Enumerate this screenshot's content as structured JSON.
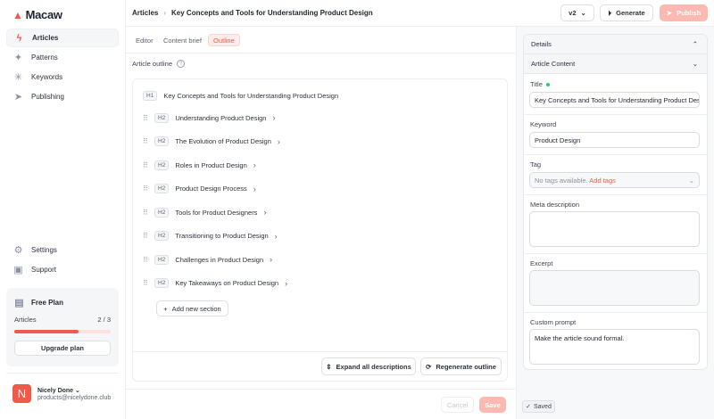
{
  "app": {
    "name": "Macaw"
  },
  "sidebar": {
    "items": [
      {
        "label": "Articles",
        "icon": "bolt-icon"
      },
      {
        "label": "Patterns",
        "icon": "sparkles-icon"
      },
      {
        "label": "Keywords",
        "icon": "asterisk-icon"
      },
      {
        "label": "Publishing",
        "icon": "send-icon"
      }
    ],
    "bottom": [
      {
        "label": "Settings"
      },
      {
        "label": "Support"
      }
    ],
    "plan": {
      "title": "Free Plan",
      "articles_label": "Articles",
      "count": "2 / 3",
      "progress": 0.667,
      "upgrade": "Upgrade plan"
    },
    "user": {
      "initial": "N",
      "name": "Nicely Done",
      "email": "products@nicelydone.club"
    }
  },
  "header": {
    "breadcrumb_root": "Articles",
    "breadcrumb_current": "Key Concepts and Tools for Understanding Product Design",
    "version": "v2",
    "generate": "Generate",
    "publish": "Publish"
  },
  "tabs": [
    {
      "label": "Editor"
    },
    {
      "label": "Content brief"
    },
    {
      "label": "Outline"
    }
  ],
  "outline": {
    "label": "Article outline",
    "h1": {
      "level": "H1",
      "text": "Key Concepts and Tools for Understanding Product Design"
    },
    "sections": [
      {
        "level": "H2",
        "text": "Understanding Product Design"
      },
      {
        "level": "H2",
        "text": "The Evolution of Product Design"
      },
      {
        "level": "H2",
        "text": "Roles in Product Design"
      },
      {
        "level": "H2",
        "text": "Product Design Process"
      },
      {
        "level": "H2",
        "text": "Tools for Product Designers"
      },
      {
        "level": "H2",
        "text": "Transitioning to Product Design"
      },
      {
        "level": "H2",
        "text": "Challenges in Product Design"
      },
      {
        "level": "H2",
        "text": "Key Takeaways on Product Design"
      }
    ],
    "add_section": "Add new section",
    "expand": "Expand all descriptions",
    "regenerate": "Regenerate outline"
  },
  "footer": {
    "cancel": "Cancel",
    "save": "Save",
    "saved": "Saved"
  },
  "details": {
    "title": "Details",
    "section": "Article Content",
    "title_label": "Title",
    "title_value": "Key Concepts and Tools for Understanding Product Design",
    "keyword_label": "Keyword",
    "keyword_value": "Product Design",
    "tag_label": "Tag",
    "tag_empty": "No tags available.",
    "tag_add": "Add tags",
    "meta_label": "Meta description",
    "meta_value": "",
    "excerpt_label": "Excerpt",
    "excerpt_value": "",
    "prompt_label": "Custom prompt",
    "prompt_value": "Make the article sound formal."
  },
  "colors": {
    "accent": "#f05a4a",
    "accent_light": "#fbb9b2"
  }
}
